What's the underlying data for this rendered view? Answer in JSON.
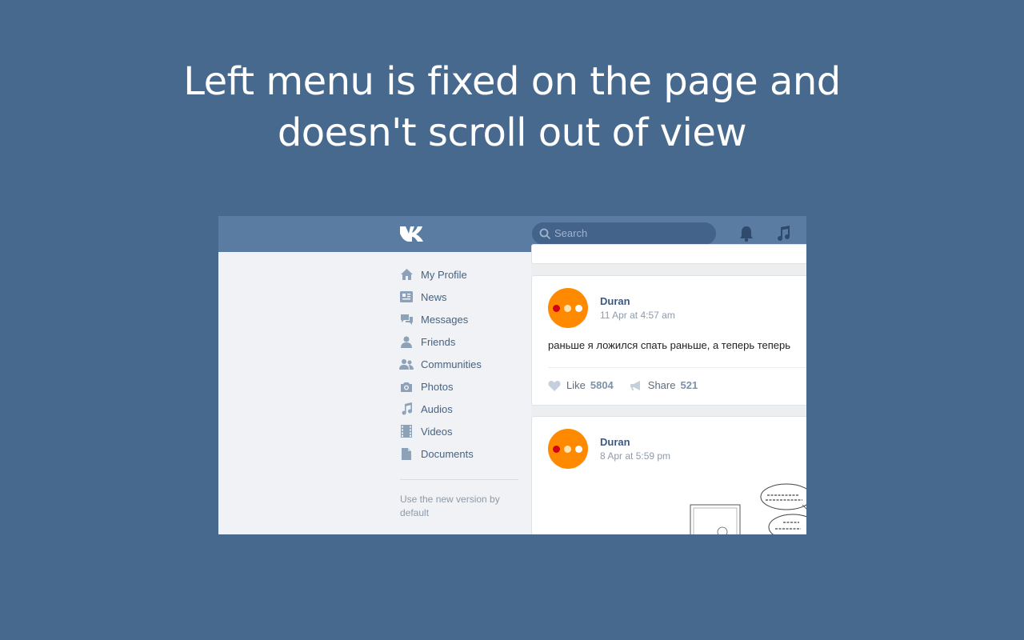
{
  "headline": {
    "line1": "Left menu is fixed on the page and",
    "line2": "doesn't scroll out of view"
  },
  "topbar": {
    "logo_icon": "vk-logo-icon",
    "search_placeholder": "Search",
    "icons": [
      "bell-icon",
      "music-icon"
    ]
  },
  "menu": {
    "items": [
      {
        "label": "My Profile",
        "icon": "home-icon"
      },
      {
        "label": "News",
        "icon": "news-icon"
      },
      {
        "label": "Messages",
        "icon": "messages-icon"
      },
      {
        "label": "Friends",
        "icon": "friend-icon"
      },
      {
        "label": "Communities",
        "icon": "communities-icon"
      },
      {
        "label": "Photos",
        "icon": "camera-icon"
      },
      {
        "label": "Audios",
        "icon": "music-note-icon"
      },
      {
        "label": "Videos",
        "icon": "film-icon"
      },
      {
        "label": "Documents",
        "icon": "document-icon"
      }
    ],
    "footer": "Use the new version by default"
  },
  "posts": [
    {
      "author": "Duran",
      "date": "11 Apr at 4:57 am",
      "text": "раньше я ложился спать раньше, а теперь теперь",
      "like_label": "Like",
      "like_count": "5804",
      "share_label": "Share",
      "share_count": "521"
    },
    {
      "author": "Duran",
      "date": "8 Apr at 5:59 pm"
    }
  ],
  "colors": {
    "background": "#48698e",
    "topbar": "#5b7ca2",
    "avatar": "#ff8a00",
    "link": "#456386"
  }
}
